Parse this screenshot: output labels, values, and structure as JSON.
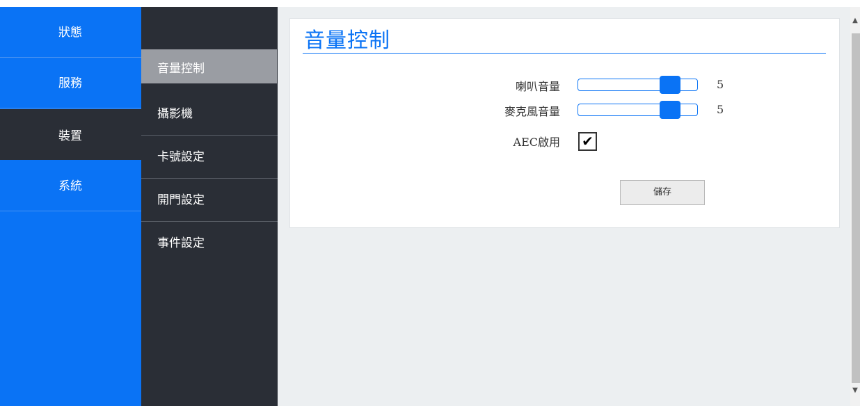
{
  "nav_primary": [
    {
      "label": "狀態"
    },
    {
      "label": "服務"
    },
    {
      "label": "裝置"
    },
    {
      "label": "系統"
    }
  ],
  "nav_secondary": [
    {
      "label": "音量控制"
    },
    {
      "label": "攝影機"
    },
    {
      "label": "卡號設定"
    },
    {
      "label": "開門設定"
    },
    {
      "label": "事件設定"
    }
  ],
  "panel": {
    "title": "音量控制",
    "speaker": {
      "label": "喇叭音量",
      "value": "5",
      "level": 0.83
    },
    "mic": {
      "label": "麥克風音量",
      "value": "5",
      "level": 0.83
    },
    "aec": {
      "label": "AEC啟用",
      "checked": true,
      "mark": "✔"
    },
    "save_label": "儲存"
  },
  "scrollbar": {
    "up_icon": "chevron-up-icon",
    "down_icon": "chevron-down-icon"
  },
  "colors": {
    "accent": "#0a73f5",
    "dark_nav": "#2a2e36",
    "content_bg": "#eceff1"
  }
}
